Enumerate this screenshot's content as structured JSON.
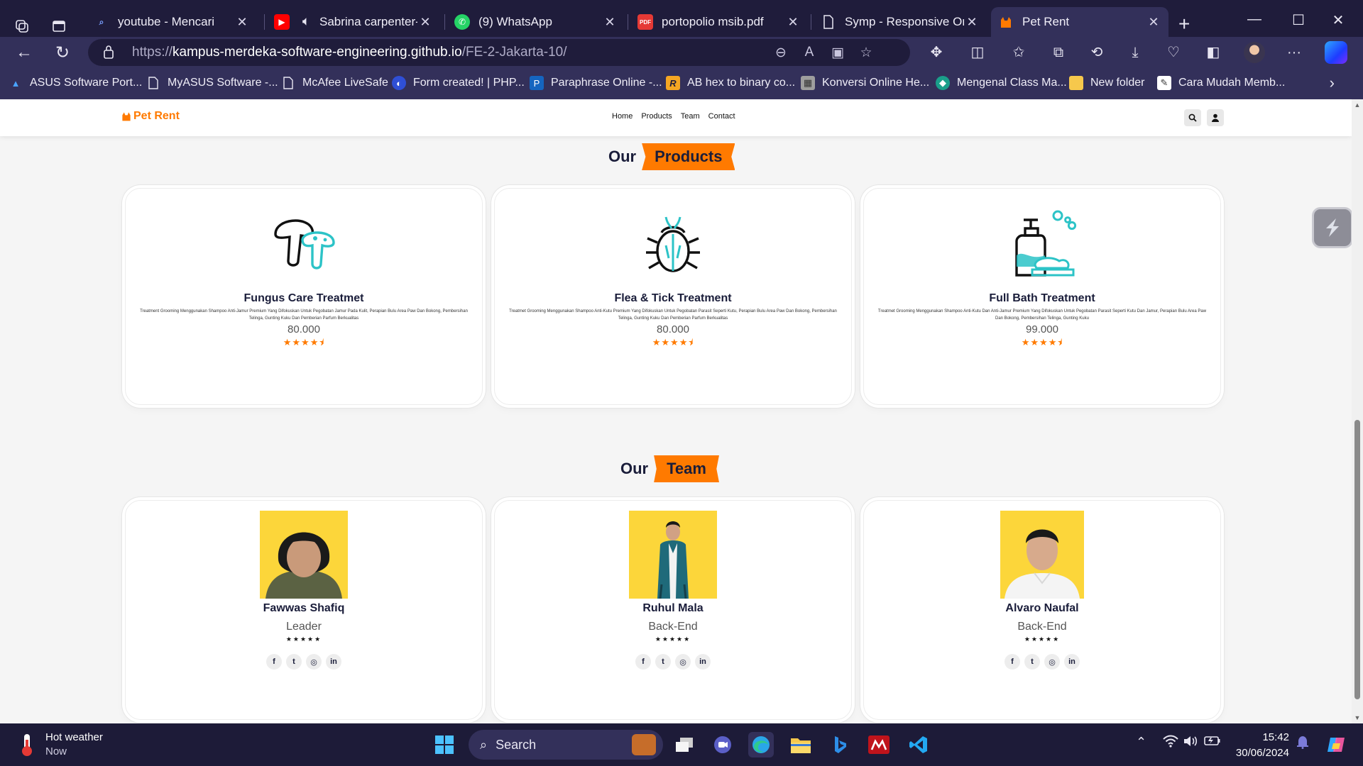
{
  "browser": {
    "tabs": [
      {
        "label": "youtube - Mencari",
        "favicon": "search-icon"
      },
      {
        "label": "Sabrina carpenter-Espresso",
        "favicon": "youtube-icon"
      },
      {
        "label": "(9) WhatsApp",
        "favicon": "whatsapp-icon"
      },
      {
        "label": "portopolio msib.pdf",
        "favicon": "pdf-icon"
      },
      {
        "label": "Symp - Responsive One Page",
        "favicon": "document-icon"
      },
      {
        "label": "Pet Rent",
        "favicon": "cat-icon"
      }
    ],
    "url_prefix": "https://",
    "url_host": "kampus-merdeka-software-engineering.github.io",
    "url_path": "/FE-2-Jakarta-10/",
    "bookmarks": [
      {
        "label": "ASUS Software Port...",
        "icon": "asus-icon"
      },
      {
        "label": "MyASUS Software -...",
        "icon": "document-icon"
      },
      {
        "label": "McAfee LiveSafe",
        "icon": "document-icon"
      },
      {
        "label": "Form created! | PHP...",
        "icon": "globe-icon"
      },
      {
        "label": "Paraphrase Online -...",
        "icon": "paraphrase-icon"
      },
      {
        "label": "AB hex to binary co...",
        "icon": "r-icon"
      },
      {
        "label": "Konversi Online He...",
        "icon": "calculator-icon"
      },
      {
        "label": "Mengenal Class Ma...",
        "icon": "globe-icon"
      },
      {
        "label": "New folder",
        "icon": "folder-icon"
      },
      {
        "label": "Cara Mudah Memb...",
        "icon": "image-icon"
      }
    ]
  },
  "site": {
    "brand": "Pet Rent",
    "brand_color": "#ff7a00",
    "nav": [
      "Home",
      "Products",
      "Team",
      "Contact"
    ],
    "products_title": {
      "plain": "Our",
      "highlight": "Products"
    },
    "team_title": {
      "plain": "Our",
      "highlight": "Team"
    },
    "products": [
      {
        "name": "Fungus Care Treatmet",
        "icon": "mushroom-icon",
        "description": "Treatment Grooming Menggunakan Shampoo Anti-Jamur Premium Yang Difokuskan Untuk Pegobatan Jamur Pada Kulit, Perapian Bulu Area Paw Dan Bokong, Pembersihan Telinga, Gunting Kuku Dan Pemberian Parfum Berkualitas",
        "price": "80.000",
        "rating": 4.5
      },
      {
        "name": "Flea & Tick Treatment",
        "icon": "bug-icon",
        "description": "Treatmet Grooming Menggunakan Shampoo Anti-Kutu Premium Yang Difokuskan Untuk Pegobatan Parasit Seperti Kutu, Perapian Bulu Area Paw Dan Bokong, Pembersihan Telinga, Gunting Kuku Dan Pemberian Parfum Berkualitas",
        "price": "80.000",
        "rating": 4.5
      },
      {
        "name": "Full Bath Treatment",
        "icon": "shampoo-icon",
        "description": "Treatmet Grooming Menggunakan Shampoo Anti-Kutu Dan Anti-Jamur Premium Yang Difokuskan Untuk Pegobatan Parasit Seperti Kutu Dan Jamur, Perapian Bulu Area Paw Dan Bokong, Pembersihan Telinga, Gunting Kuku",
        "price": "99.000",
        "rating": 4.5
      }
    ],
    "team": [
      {
        "name": "Fawwas Shafiq",
        "role": "Leader",
        "stars": "★★★★★",
        "photo": "avatar-headscarf"
      },
      {
        "name": "Ruhul Mala",
        "role": "Back-End",
        "stars": "★★★★★",
        "photo": "avatar-blazer"
      },
      {
        "name": "Alvaro Naufal",
        "role": "Back-End",
        "stars": "★★★★★",
        "photo": "avatar-white-shirt"
      }
    ],
    "social_icons": [
      "facebook-icon",
      "twitter-icon",
      "instagram-icon",
      "linkedin-icon"
    ]
  },
  "taskbar": {
    "weather_title": "Hot weather",
    "weather_sub": "Now",
    "search_label": "Search",
    "time": "15:42",
    "date": "30/06/2024"
  }
}
